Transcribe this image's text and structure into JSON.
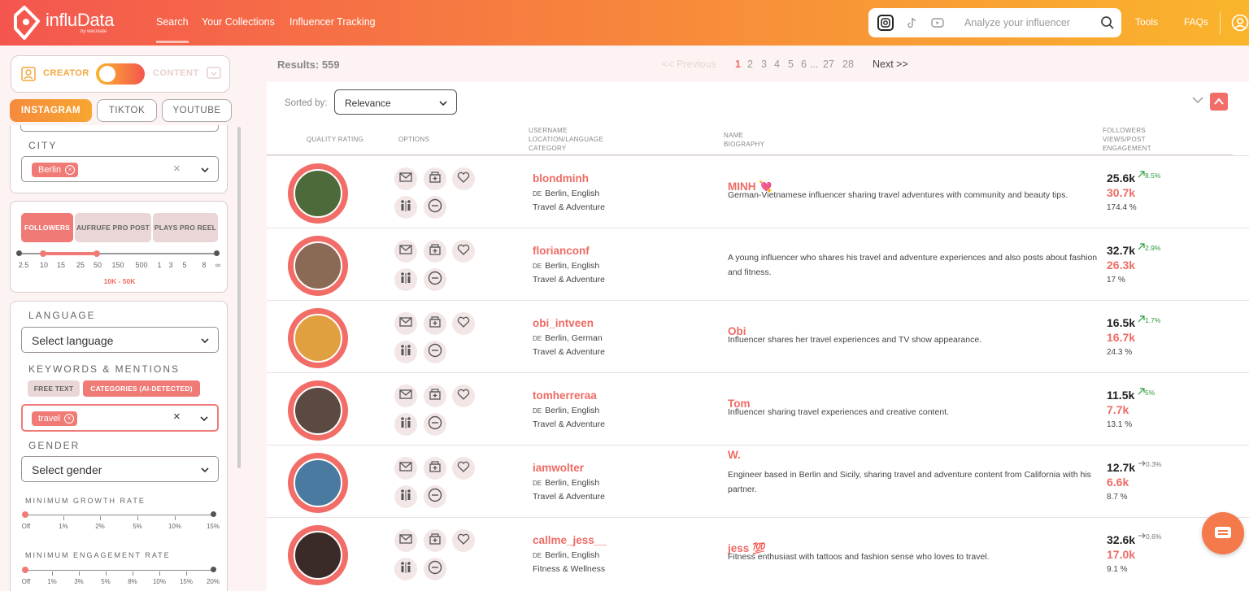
{
  "app": {
    "logo_name": "influData",
    "logo_sub": "by wecreate"
  },
  "nav": {
    "search": "Search",
    "collections": "Your Collections",
    "tracking": "Influencer Tracking"
  },
  "search": {
    "placeholder": "Analyze your influencer"
  },
  "top_links": {
    "tools": "Tools",
    "faqs": "FAQs"
  },
  "sidebar": {
    "mode_creator": "CREATOR",
    "mode_content": "CONTENT",
    "platforms": [
      "INSTAGRAM",
      "TIKTOK",
      "YOUTUBE"
    ],
    "city_label": "CITY",
    "city_chip": "Berlin",
    "metric_tabs": [
      "FOLLOWERS",
      "AUFRUFE PRO POST",
      "PLAYS PRO REEL"
    ],
    "follower_ticks": [
      "2.5",
      "10",
      "15",
      "25",
      "50",
      "150",
      "500",
      "1",
      "3",
      "5",
      "8",
      "∞"
    ],
    "follower_range": "10K - 50K",
    "language_label": "LANGUAGE",
    "language_placeholder": "Select language",
    "keywords_label": "KEYWORDS & MENTIONS",
    "kw_tabs": [
      "FREE TEXT",
      "CATEGORIES (AI-DETECTED)"
    ],
    "kw_chip": "travel",
    "gender_label": "GENDER",
    "gender_placeholder": "Select gender",
    "growth_label": "MINIMUM GROWTH RATE",
    "growth_ticks": [
      "Off",
      "1%",
      "2%",
      "5%",
      "10%",
      "15%"
    ],
    "engagement_label": "MINIMUM ENGAGEMENT RATE",
    "engagement_ticks": [
      "Off",
      "1%",
      "3%",
      "5%",
      "8%",
      "10%",
      "15%",
      "20%"
    ]
  },
  "results": {
    "count_label": "Results: 559",
    "prev": "<< Previous",
    "pages": [
      "1",
      "2",
      "3",
      "4",
      "5",
      "6",
      "...",
      "27",
      "28"
    ],
    "next": "Next >>",
    "sorted_by": "Sorted by:",
    "sort_value": "Relevance"
  },
  "columns": {
    "quality": "QUALITY RATING",
    "options": "OPTIONS",
    "username_1": "USERNAME",
    "username_2": "LOCATION/LANGUAGE",
    "username_3": "CATEGORY",
    "name_1": "NAME",
    "name_2": "BIOGRAPHY",
    "followers_1": "FOLLOWERS",
    "followers_2": "VIEWS/POST",
    "followers_3": "ENGAGEMENT"
  },
  "rows": [
    {
      "username": "blondminh",
      "cc": "DE",
      "location": "Berlin, English",
      "category": "Travel & Adventure",
      "name": "MINH 💘",
      "bio": "German-Vietnamese influencer sharing travel adventures with community and beauty tips.",
      "followers": "25.6k",
      "growth": "8.5%",
      "views": "30.7k",
      "engagement": "174.4 %",
      "trend": "up",
      "avatar_color": "#4d6b3a"
    },
    {
      "username": "florianconf",
      "cc": "DE",
      "location": "Berlin, English",
      "category": "Travel & Adventure",
      "name": "",
      "bio": "A young influencer who shares his travel and adventure experiences and also posts about fashion and fitness.",
      "followers": "32.7k",
      "growth": "2.9%",
      "views": "26.3k",
      "engagement": "17 %",
      "trend": "up",
      "avatar_color": "#8a6a55"
    },
    {
      "username": "obi_intveen",
      "cc": "DE",
      "location": "Berlin, German",
      "category": "Travel & Adventure",
      "name": "Obi",
      "bio": "Influencer shares her travel experiences and TV show appearance.",
      "followers": "16.5k",
      "growth": "1.7%",
      "views": "16.7k",
      "engagement": "24.3 %",
      "trend": "up",
      "avatar_color": "#e0a040"
    },
    {
      "username": "tomherreraa",
      "cc": "DE",
      "location": "Berlin, English",
      "category": "Travel & Adventure",
      "name": "Tom",
      "bio": "Influencer sharing travel experiences and creative content.",
      "followers": "11.5k",
      "growth": "5%",
      "views": "7.7k",
      "engagement": "13.1 %",
      "trend": "up",
      "avatar_color": "#5a4a42"
    },
    {
      "username": "iamwolter",
      "cc": "DE",
      "location": "Berlin, English",
      "category": "Travel & Adventure",
      "name": "W.",
      "bio": "Engineer based in Berlin and Sicily, sharing travel and adventure content from California with his partner.",
      "followers": "12.7k",
      "growth": "0.3%",
      "views": "6.6k",
      "engagement": "8.7 %",
      "trend": "flat",
      "avatar_color": "#4a7aa0"
    },
    {
      "username": "callme_jess__",
      "cc": "DE",
      "location": "Berlin, English",
      "category": "Fitness & Wellness",
      "name": "jess 💯",
      "bio": "Fitness enthusiast with tattoos and fashion sense who loves to travel.",
      "followers": "32.6k",
      "growth": "0.6%",
      "views": "17.0k",
      "engagement": "9.1 %",
      "trend": "flat",
      "avatar_color": "#3a2a28"
    }
  ],
  "colors": {
    "accent": "#ee6b64",
    "gradient_start": "#f4564f",
    "gradient_end": "#fab52c",
    "growth_up": "#2e9a3a",
    "growth_flat": "#777777"
  }
}
